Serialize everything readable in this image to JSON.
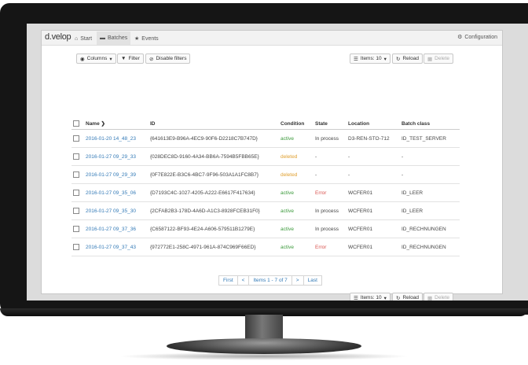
{
  "brand": "d.velop",
  "nav": {
    "start": "Start",
    "batches": "Batches",
    "events": "Events",
    "configuration": "Configuration"
  },
  "toolbar": {
    "columns": "Columns",
    "filter": "Filter",
    "disable_filters": "Disable filters",
    "items": "Items: 10",
    "reload": "Reload",
    "delete": "Delete"
  },
  "table": {
    "headers": [
      "Name",
      "ID",
      "Condition",
      "State",
      "Location",
      "Batch class"
    ],
    "rows": [
      {
        "name": "2016-01-20 14_48_23",
        "id": "{641613E9-B96A-4EC9-90F6-D2218C7B747D}",
        "condition": "active",
        "state": "In process",
        "location": "D3-REN-STO-712",
        "batch_class": "ID_TEST_SERVER"
      },
      {
        "name": "2016-01-27 09_29_33",
        "id": "{028DEC8D-9160-4A34-BB6A-7594B5FBB65E}",
        "condition": "deleted",
        "state": "-",
        "location": "-",
        "batch_class": "-"
      },
      {
        "name": "2016-01-27 09_29_39",
        "id": "{0F7E822E-B3C6-4BC7-9F96-503A1A1FC8B7}",
        "condition": "deleted",
        "state": "-",
        "location": "-",
        "batch_class": "-"
      },
      {
        "name": "2016-01-27 09_35_06",
        "id": "{D7193C4C-1027-4205-A222-E6617F417634}",
        "condition": "active",
        "state": "Error",
        "location": "WCFER01",
        "batch_class": "ID_LEER"
      },
      {
        "name": "2016-01-27 09_35_30",
        "id": "{2CFAB2B3-178D-4A6D-A1C3-8928FCEB31F0}",
        "condition": "active",
        "state": "In process",
        "location": "WCFER01",
        "batch_class": "ID_LEER"
      },
      {
        "name": "2016-01-27 09_37_36",
        "id": "{C6587122-BF93-4E24-A606-579511B1279E}",
        "condition": "active",
        "state": "In process",
        "location": "WCFER01",
        "batch_class": "ID_RECHNUNGEN"
      },
      {
        "name": "2016-01-27 09_37_43",
        "id": "{972772E1-258C-4971-961A-874C969F66ED}",
        "condition": "active",
        "state": "Error",
        "location": "WCFER01",
        "batch_class": "ID_RECHNUNGEN"
      }
    ]
  },
  "pager": {
    "first": "First",
    "prev": "<",
    "info": "Items 1 - 7 of 7",
    "next": ">",
    "last": "Last"
  },
  "icons": {
    "home": "home-icon",
    "batches": "batches-icon",
    "events": "star-icon",
    "config": "gear-icon",
    "columns": "eye-icon",
    "filter": "filter-icon",
    "disable_filters": "disable-filter-icon",
    "items": "list-icon",
    "reload": "refresh-icon",
    "delete": "trash-icon",
    "sort": "chevron-down-icon"
  },
  "colors": {
    "link": "#337ab7",
    "active": "#3c9a3c",
    "deleted": "#e0a030",
    "error": "#d9534f"
  }
}
